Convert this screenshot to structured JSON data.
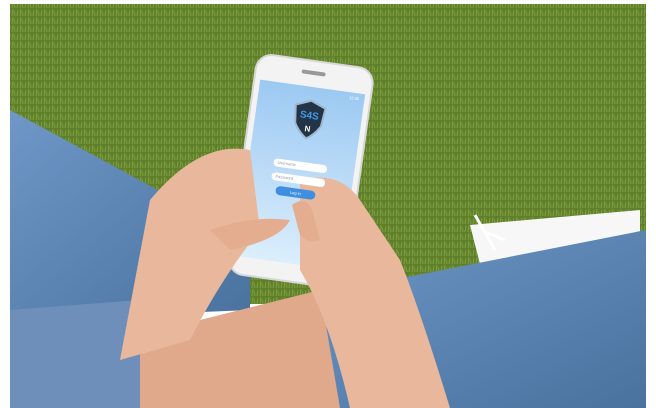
{
  "app": {
    "logo_text": "S4S",
    "logo_badge": "N",
    "status_time": "12:30",
    "username_placeholder": "Username",
    "password_placeholder": "Password",
    "login_label": "Log in"
  },
  "colors": {
    "grass": "#5f7f2c",
    "jeans": "#5b83b4",
    "skin": "#e9b89c",
    "screen_top": "#9cc9f2",
    "screen_bottom": "#dbeefc",
    "shield": "#243447"
  }
}
